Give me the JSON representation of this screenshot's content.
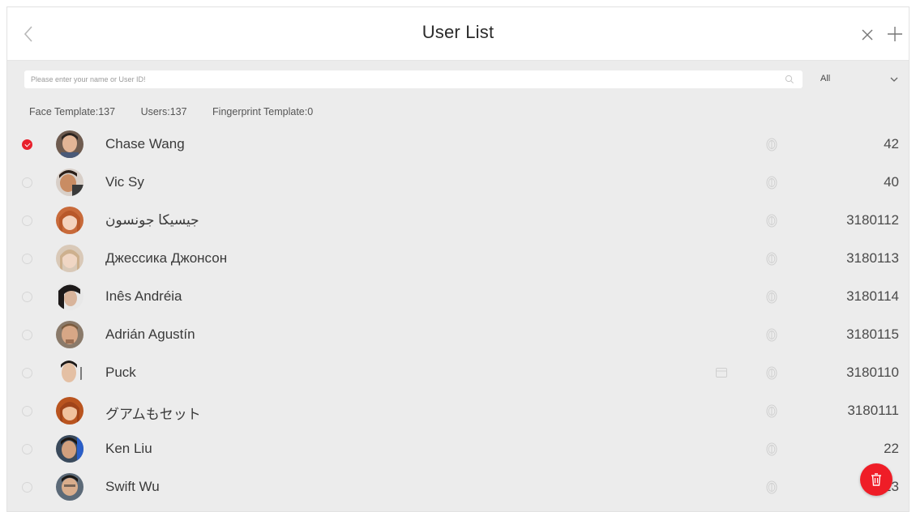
{
  "header": {
    "title": "User List",
    "back_icon": "chevron-left-icon",
    "close_icon": "close-icon",
    "add_icon": "plus-icon"
  },
  "search": {
    "placeholder": "Please enter your name or User ID!",
    "value": "",
    "icon": "search-icon"
  },
  "filter": {
    "selected": "All",
    "icon": "chevron-down-icon"
  },
  "stats": {
    "face": "Face Template:137",
    "users": "Users:137",
    "fingerprint": "Fingerprint Template:0"
  },
  "users": [
    {
      "name": "Chase Wang",
      "id": "42",
      "selected": true,
      "has_card": false
    },
    {
      "name": "Vic Sy",
      "id": "40",
      "selected": false,
      "has_card": false
    },
    {
      "name": "جيسيكا جونسون",
      "id": "3180112",
      "selected": false,
      "has_card": false
    },
    {
      "name": "Джессика Джонсон",
      "id": "3180113",
      "selected": false,
      "has_card": false
    },
    {
      "name": "Inês Andréia",
      "id": "3180114",
      "selected": false,
      "has_card": false
    },
    {
      "name": "Adrián Agustín",
      "id": "3180115",
      "selected": false,
      "has_card": false
    },
    {
      "name": "Puck",
      "id": "3180110",
      "selected": false,
      "has_card": true
    },
    {
      "name": "グアムもセット",
      "id": "3180111",
      "selected": false,
      "has_card": false
    },
    {
      "name": "Ken Liu",
      "id": "22",
      "selected": false,
      "has_card": false
    },
    {
      "name": "Swift Wu",
      "id": "23",
      "selected": false,
      "has_card": false
    }
  ],
  "colors": {
    "accent": "#e8212c",
    "background": "#ececec",
    "header": "#ffffff"
  },
  "fab": {
    "icon": "trash-icon"
  }
}
